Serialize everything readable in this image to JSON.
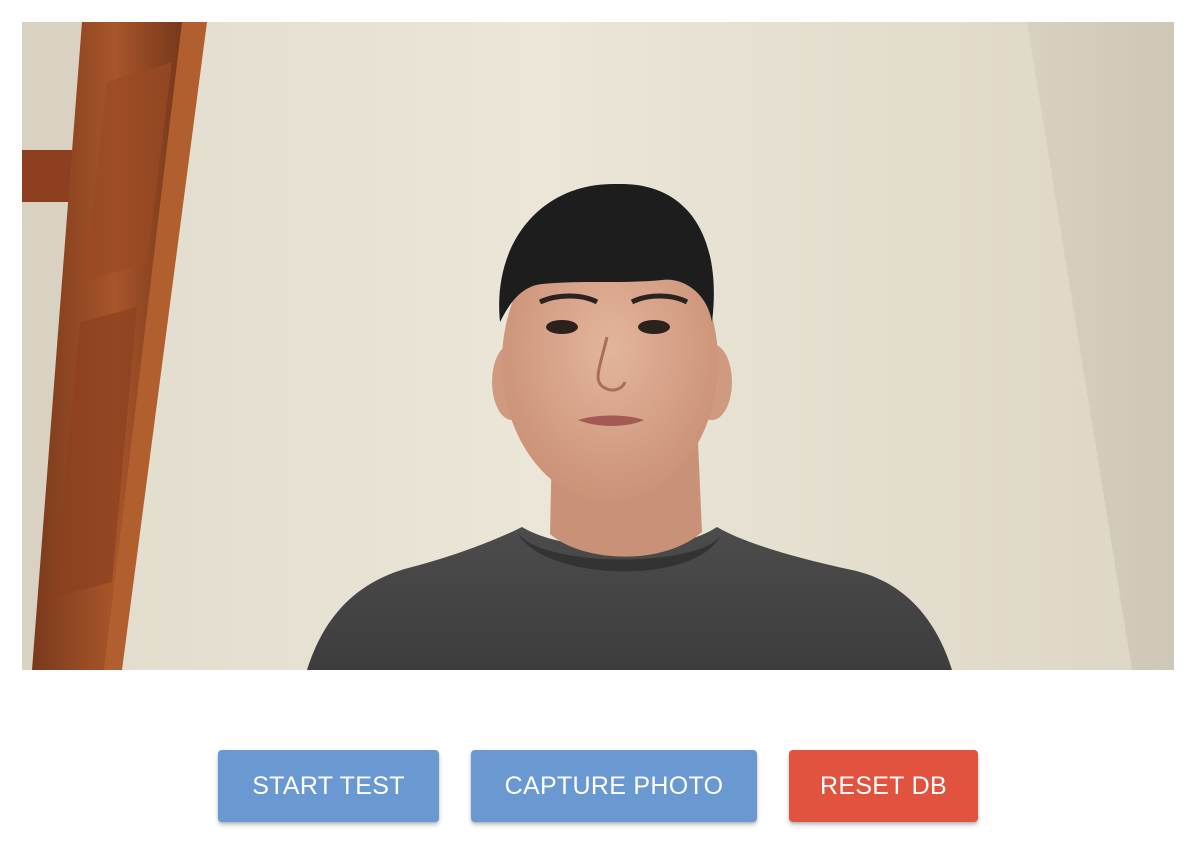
{
  "video": {
    "icon": "webcam-feed"
  },
  "controls": {
    "start_test_label": "START TEST",
    "capture_photo_label": "CAPTURE PHOTO",
    "reset_db_label": "RESET DB"
  },
  "colors": {
    "primary_button": "#6a98d0",
    "danger_button": "#e1533f",
    "page_background": "#ffffff"
  }
}
